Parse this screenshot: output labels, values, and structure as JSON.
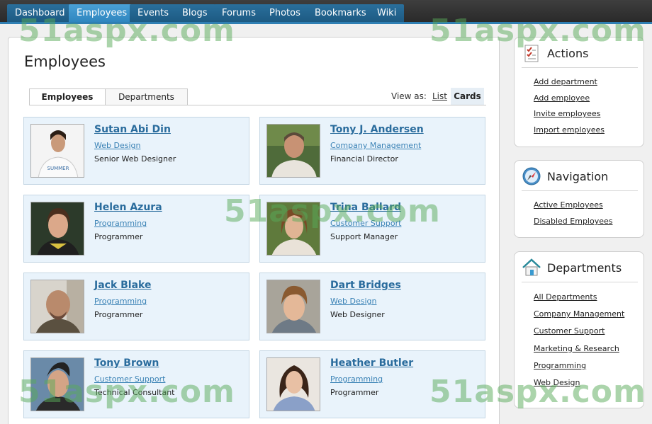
{
  "topnav": {
    "tabs": [
      {
        "label": "Dashboard"
      },
      {
        "label": "Employees"
      },
      {
        "label": "Events"
      },
      {
        "label": "Blogs"
      },
      {
        "label": "Forums"
      },
      {
        "label": "Photos"
      },
      {
        "label": "Bookmarks"
      },
      {
        "label": "Wiki"
      }
    ],
    "active": "Employees"
  },
  "main": {
    "title": "Employees",
    "tabs": [
      {
        "label": "Employees"
      },
      {
        "label": "Departments"
      }
    ],
    "view_as": {
      "label": "View as:",
      "list": "List",
      "cards": "Cards",
      "selected": "Cards"
    }
  },
  "employees": [
    {
      "name": "Sutan Abi Din",
      "department": "Web Design",
      "title": "Senior Web Designer"
    },
    {
      "name": "Tony J. Andersen",
      "department": "Company Management",
      "title": "Financial Director"
    },
    {
      "name": "Helen Azura",
      "department": "Programming",
      "title": "Programmer"
    },
    {
      "name": "Trina Ballard",
      "department": "Customer Support",
      "title": "Support Manager"
    },
    {
      "name": "Jack Blake",
      "department": "Programming",
      "title": "Programmer"
    },
    {
      "name": "Dart Bridges",
      "department": "Web Design",
      "title": "Web Designer"
    },
    {
      "name": "Tony Brown",
      "department": "Customer Support",
      "title": "Technical Consultant"
    },
    {
      "name": "Heather Butler",
      "department": "Programming",
      "title": "Programmer"
    }
  ],
  "sidebar": {
    "actions": {
      "title": "Actions",
      "icon": "checklist-icon",
      "links": [
        "Add department",
        "Add employee",
        "Invite employees",
        "Import employees"
      ]
    },
    "navigation": {
      "title": "Navigation",
      "icon": "compass-icon",
      "links": [
        "Active Employees",
        "Disabled Employees"
      ]
    },
    "departments": {
      "title": "Departments",
      "icon": "house-icon",
      "links": [
        "All Departments",
        "Company Management",
        "Customer Support",
        "Marketing & Research",
        "Programming",
        "Web Design"
      ]
    }
  },
  "watermark": "51aspx.com",
  "colors": {
    "nav_bar": "#333333",
    "nav_tab": "#1d5a82",
    "nav_tab_active": "#3a95cf",
    "card_bg": "#e9f3fb",
    "link": "#2a6c9d",
    "watermark": "#58aa58"
  }
}
